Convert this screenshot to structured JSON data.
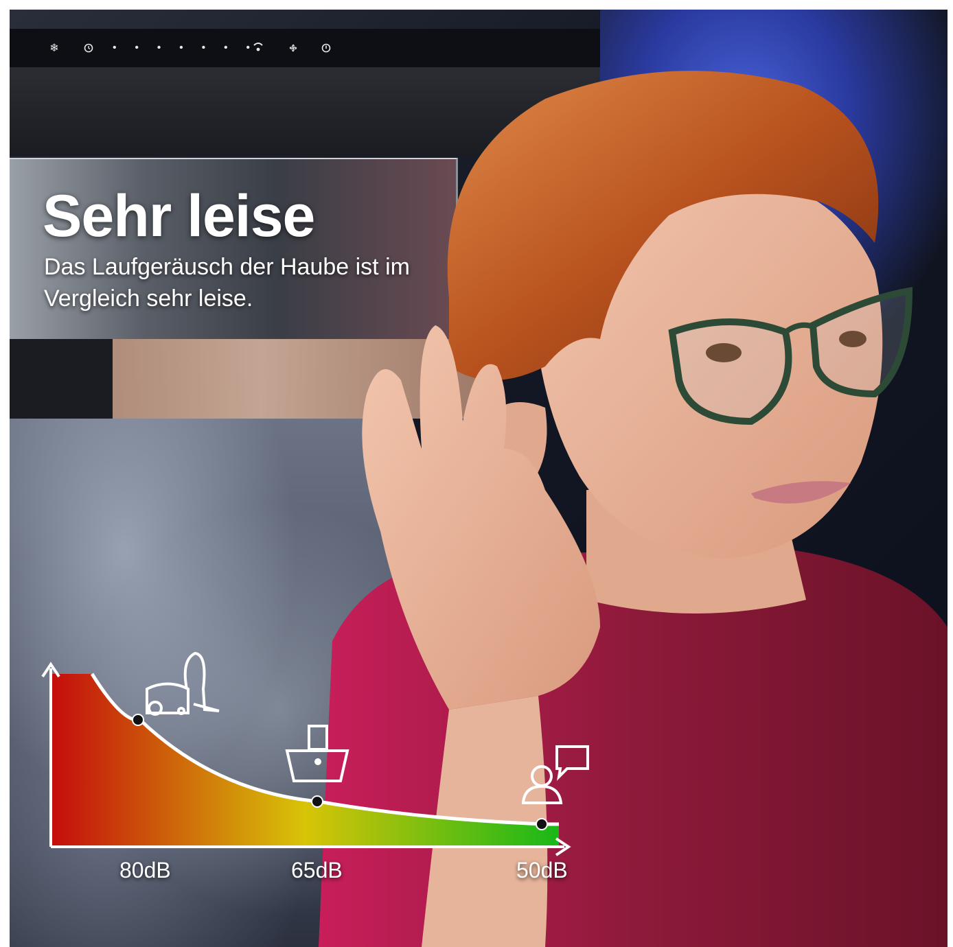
{
  "headline": "Sehr leise",
  "subline": "Das Laufgeräusch der Haube ist im Vergleich sehr leise.",
  "control_icons": [
    "snowflake-icon",
    "timer-icon",
    "dot-icon",
    "dot-icon",
    "dot-icon",
    "dot-icon",
    "dot-icon",
    "dot-icon",
    "dot-icon",
    "dot-icon",
    "fan-icon",
    "power-icon"
  ],
  "noise_levels": [
    {
      "label": "80dB",
      "value": 80,
      "icon": "vacuum-cleaner-icon"
    },
    {
      "label": "65dB",
      "value": 65,
      "icon": "kitchen-mixer-icon"
    },
    {
      "label": "50dB",
      "value": 50,
      "icon": "conversation-icon"
    }
  ],
  "colors": {
    "loud": "#c40c0c",
    "medium": "#d8c408",
    "quiet": "#18b818",
    "text": "#ffffff"
  }
}
